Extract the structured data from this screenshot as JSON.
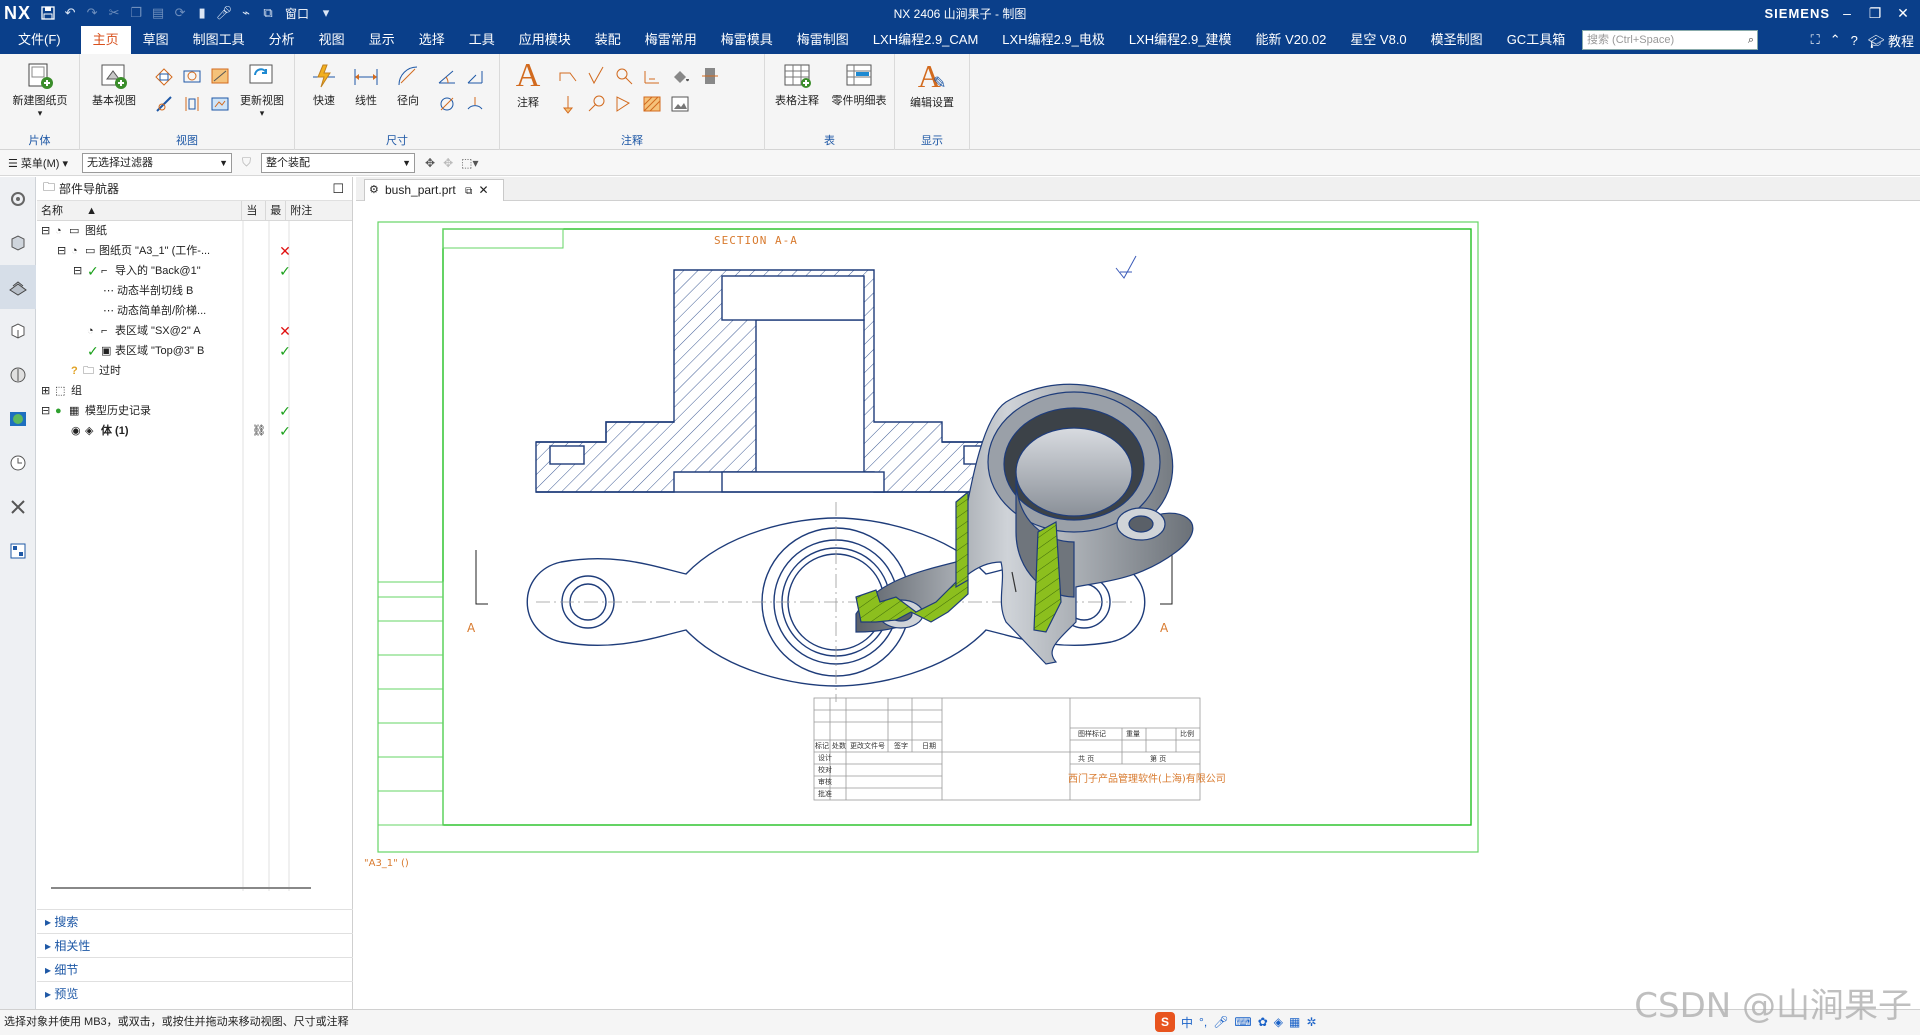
{
  "app": {
    "logo": "NX",
    "title": "NX 2406 山涧果子 - 制图",
    "brand": "SIEMENS",
    "window_menu": "窗口"
  },
  "menubar": {
    "file": "文件(F)",
    "items": [
      "主页",
      "草图",
      "制图工具",
      "分析",
      "视图",
      "显示",
      "选择",
      "工具",
      "应用模块",
      "装配",
      "梅雷常用",
      "梅雷模具",
      "梅雷制图",
      "LXH编程2.9_CAM",
      "LXH编程2.9_电极",
      "LXH编程2.9_建模",
      "能新 V20.02",
      "星空 V8.0",
      "模圣制图",
      "GC工具箱"
    ],
    "active_index": 0,
    "search_placeholder": "搜索 (Ctrl+Space)",
    "tutorial": "教程"
  },
  "ribbon": {
    "groups": {
      "sheet": "片体",
      "view": "视图",
      "dimension": "尺寸",
      "annotation": "注释",
      "table": "表",
      "display": "显示"
    },
    "buttons": {
      "new_sheet": "新建图纸页",
      "base_view": "基本视图",
      "update_view": "更新视图",
      "rapid": "快速",
      "linear": "线性",
      "radial": "径向",
      "note": "注释",
      "tabular_note": "表格注释",
      "parts_list": "零件明细表",
      "edit_settings": "编辑设置"
    }
  },
  "selbar": {
    "menu": "菜单(M)",
    "filter": "无选择过滤器",
    "scope": "整个装配"
  },
  "navigator": {
    "title": "部件导航器",
    "columns": [
      "名称",
      "当",
      "最",
      "附注"
    ],
    "rows": [
      {
        "label": "图纸",
        "level": 0,
        "c1": "",
        "c2": ""
      },
      {
        "label": "图纸页 \"A3_1\" (工作-...",
        "level": 1,
        "c1": "",
        "c2": "cross"
      },
      {
        "label": "导入的 \"Back@1\"",
        "level": 2,
        "c1": "",
        "c2": "check"
      },
      {
        "label": "动态半剖切线 B",
        "level": 3,
        "c1": "",
        "c2": ""
      },
      {
        "label": "动态简单剖/阶梯...",
        "level": 3,
        "c1": "",
        "c2": ""
      },
      {
        "label": "表区域 \"SX@2\" A",
        "level": 2,
        "c1": "",
        "c2": "cross"
      },
      {
        "label": "表区域 \"Top@3\" B",
        "level": 2,
        "c1": "",
        "c2": "check"
      },
      {
        "label": "过时",
        "level": 1,
        "c1": "",
        "c2": ""
      },
      {
        "label": "组",
        "level": 0,
        "c1": "",
        "c2": ""
      },
      {
        "label": "模型历史记录",
        "level": 0,
        "c1": "",
        "c2": "check"
      },
      {
        "label": "体 (1)",
        "level": 1,
        "c1": "link",
        "c2": "check"
      }
    ],
    "panels": [
      "搜索",
      "相关性",
      "细节",
      "预览"
    ]
  },
  "tab": {
    "label": "bush_part.prt"
  },
  "drawing": {
    "section_title": "SECTION  A-A",
    "section_marker": "A",
    "sheet_name": "\"A3_1\"  ()",
    "company": "西门子产品管理软件(上海)有限公司",
    "titleblock": {
      "mark": "标记",
      "count": "处数",
      "change_doc": "更改文件号",
      "sign": "签字",
      "date": "日期",
      "design": "设计",
      "check": "校对",
      "review": "审核",
      "approve": "批准",
      "drawing_mark": "图样标记",
      "weight": "重量",
      "scale": "比例",
      "total": "共    页",
      "page": "第    页"
    }
  },
  "status": {
    "text": "选择对象并使用 MB3，或双击，或按住并拖动来移动视图、尺寸或注释"
  },
  "ime": {
    "lang": "中"
  },
  "watermark": "CSDN @山涧果子"
}
